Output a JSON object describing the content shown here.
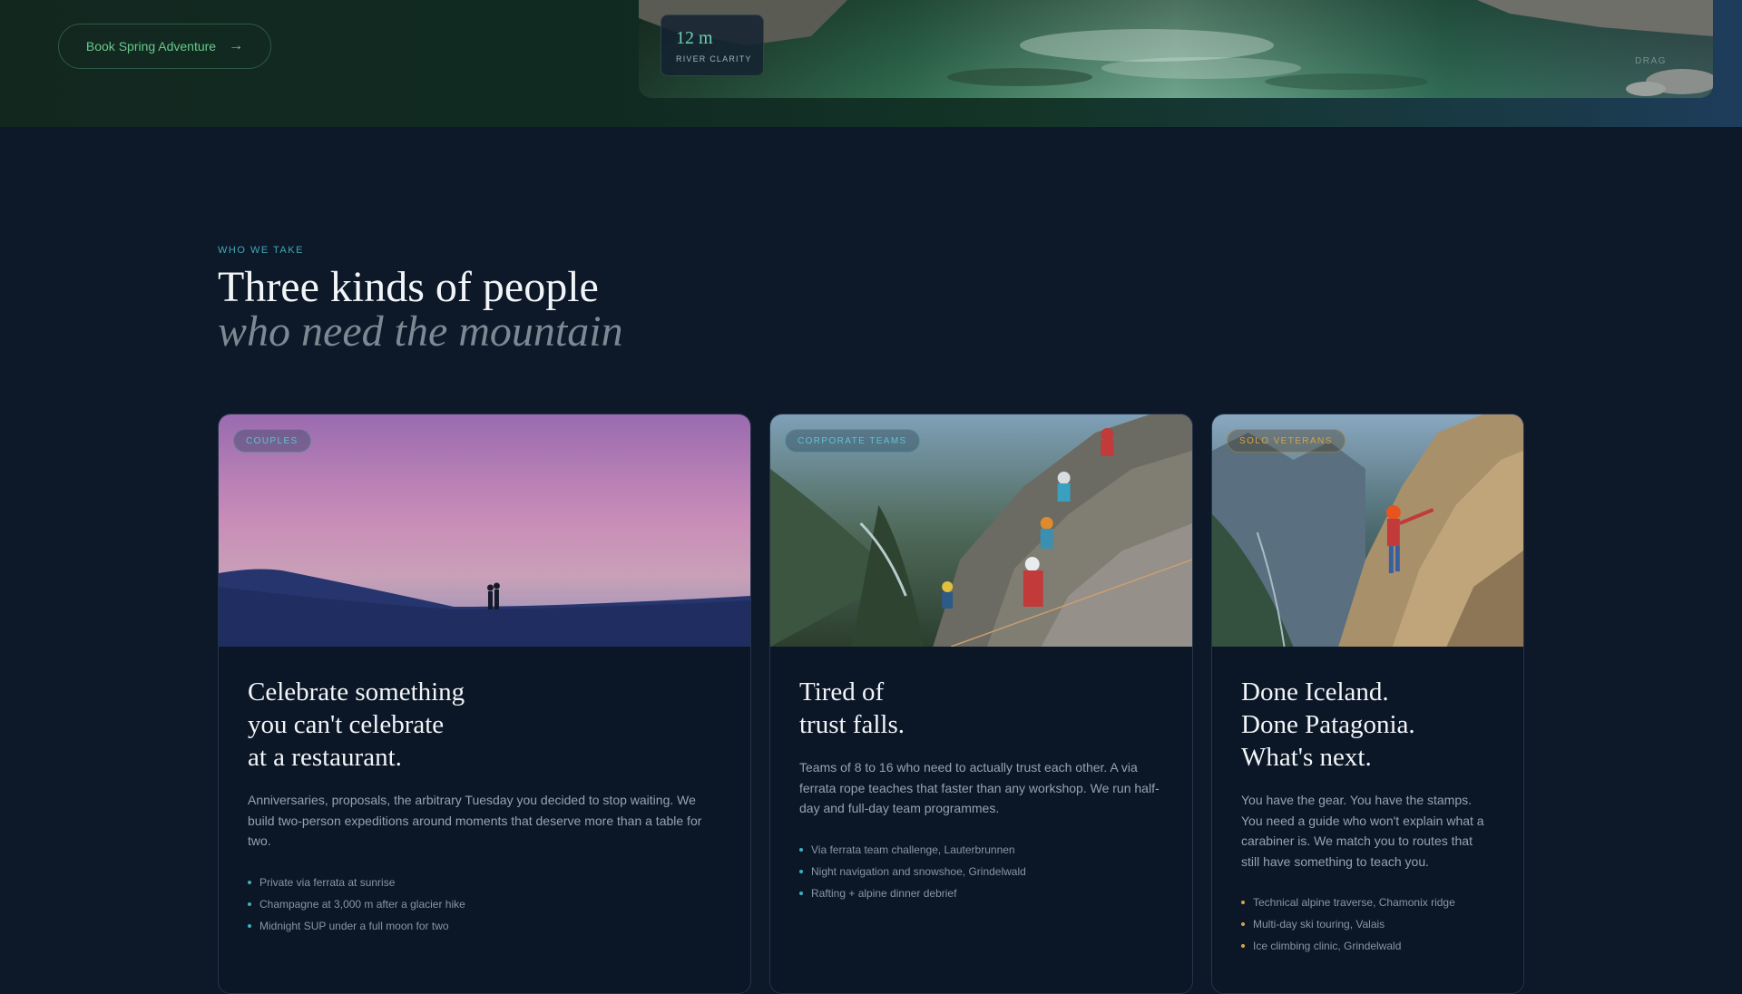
{
  "hero": {
    "book_label": "Book Spring Adventure",
    "arrow_icon": "arrow-right-icon",
    "stat_value": "12 m",
    "stat_label": "RIVER CLARITY",
    "drag_hint": "DRAG"
  },
  "section": {
    "eyebrow": "WHO WE TAKE",
    "title_line1": "Three kinds of people",
    "title_line2": "who need the mountain"
  },
  "cards": [
    {
      "badge": "COUPLES",
      "title": "Celebrate something\nyou can't celebrate\nat a restaurant.",
      "desc": "Anniversaries, proposals, the arbitrary Tuesday you decided to stop waiting. We build two-person expeditions around moments that deserve more than a table for two.",
      "items": [
        "Private via ferrata at sunrise",
        "Champagne at 3,000 m after a glacier hike",
        "Midnight SUP under a full moon for two"
      ]
    },
    {
      "badge": "CORPORATE TEAMS",
      "title": "Tired of\ntrust falls.",
      "desc": "Teams of 8 to 16 who need to actually trust each other. A via ferrata rope teaches that faster than any workshop. We run half-day and full-day team programmes.",
      "items": [
        "Via ferrata team challenge, Lauterbrunnen",
        "Night navigation and snowshoe, Grindelwald",
        "Rafting + alpine dinner debrief"
      ]
    },
    {
      "badge": "SOLO VETERANS",
      "title": "Done Iceland.\nDone Patagonia.\nWhat's next.",
      "desc": "You have the gear. You have the stamps. You need a guide who won't explain what a carabiner is. We match you to routes that still have something to teach you.",
      "items": [
        "Technical alpine traverse, Chamonix ridge",
        "Multi-day ski touring, Valais",
        "Ice climbing clinic, Grindelwald"
      ]
    }
  ],
  "colors": {
    "accent_teal": "#3fb0bd",
    "accent_gold": "#d6a24a",
    "button_green": "#69c98e",
    "background": "#0d1828"
  }
}
